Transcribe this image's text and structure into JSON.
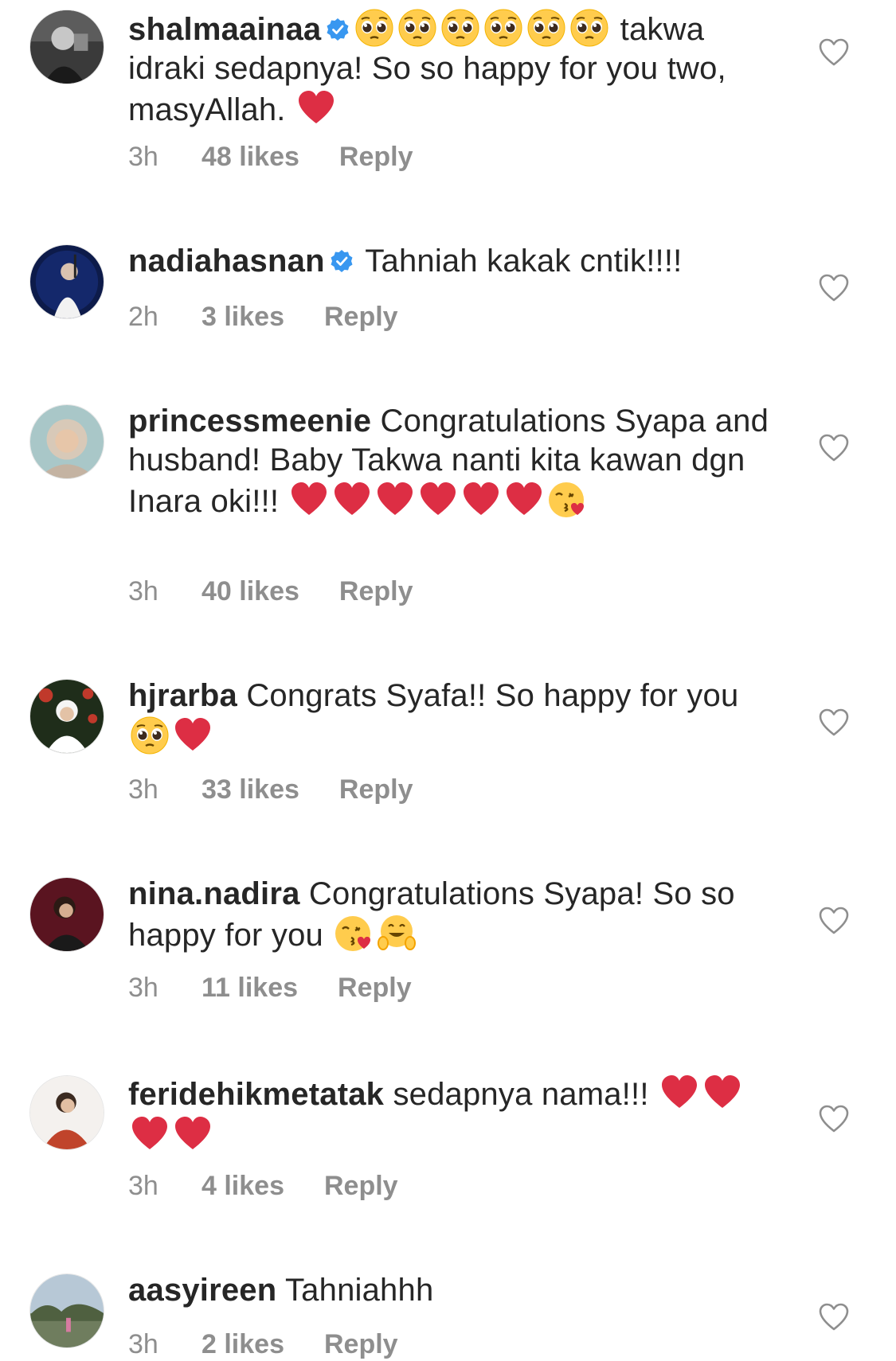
{
  "colors": {
    "verified_blue": "#3897f0",
    "heart_red": "#dd2e44",
    "meta_gray": "#8e8e8e",
    "text": "#262626"
  },
  "comments": [
    {
      "username": "shalmaainaa",
      "verified": true,
      "emojis_before": [
        "pleading-face",
        "pleading-face",
        "pleading-face",
        "pleading-face",
        "pleading-face",
        "pleading-face"
      ],
      "text": " takwa idraki sedapnya! So so happy for you two, masyAllah. ",
      "emojis_after": [
        "red-heart"
      ],
      "time": "3h",
      "likes": "48 likes",
      "reply": "Reply"
    },
    {
      "username": "nadiahasnan",
      "verified": true,
      "text": " Tahniah kakak cntik!!!!",
      "time": "2h",
      "likes": "3 likes",
      "reply": "Reply"
    },
    {
      "username": "princessmeenie",
      "verified": false,
      "text": " Congratulations Syapa and husband! Baby Takwa nanti kita kawan dgn Inara oki!!! ",
      "emojis_after": [
        "red-heart",
        "red-heart",
        "red-heart",
        "red-heart",
        "red-heart",
        "red-heart",
        "face-blowing-kiss"
      ],
      "time": "3h",
      "likes": "40 likes",
      "reply": "Reply"
    },
    {
      "username": "hjrarba",
      "verified": false,
      "text": " Congrats Syafa!! So happy for you ",
      "emojis_after": [
        "pleading-face",
        "red-heart"
      ],
      "time": "3h",
      "likes": "33 likes",
      "reply": "Reply"
    },
    {
      "username": "nina.nadira",
      "verified": false,
      "text": " Congratulations Syapa! So so happy for you ",
      "emojis_after": [
        "face-blowing-kiss",
        "hugging-face"
      ],
      "time": "3h",
      "likes": "11 likes",
      "reply": "Reply"
    },
    {
      "username": "feridehikmetatak",
      "verified": false,
      "text": " sedapnya nama!!! ",
      "emojis_after": [
        "red-heart",
        "red-heart",
        "red-heart",
        "red-heart"
      ],
      "time": "3h",
      "likes": "4 likes",
      "reply": "Reply"
    },
    {
      "username": "aasyireen",
      "verified": false,
      "text": " Tahniahhh",
      "time": "3h",
      "likes": "2 likes",
      "reply": "Reply"
    }
  ]
}
